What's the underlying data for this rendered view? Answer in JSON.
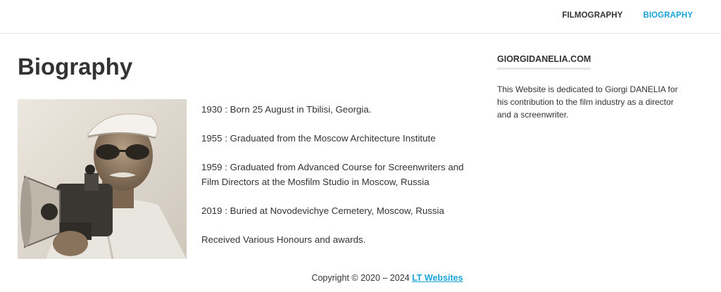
{
  "nav": {
    "items": [
      {
        "label": "FILMOGRAPHY"
      },
      {
        "label": "BIOGRAPHY"
      }
    ]
  },
  "page": {
    "title": "Biography"
  },
  "biography": {
    "entries": [
      "1930  : Born 25 August in Tbilisi, Georgia.",
      "1955 : Graduated from the Moscow Architecture Institute",
      "1959 : Graduated from Advanced Course for Screenwriters and Film Directors at the Mosfilm Studio in Moscow, Russia",
      "2019 : Buried at Novodevichye Cemetery, Moscow, Russia",
      "Received Various Honours and awards."
    ]
  },
  "sidebar": {
    "title": "GIORGIDANELIA.COM",
    "text": "This Website is dedicated to Giorgi DANELIA for his contribution to the film industry as a director and a screenwriter."
  },
  "footer": {
    "copyright": "Copyright © 2020 – 2024",
    "link_label": "LT Websites"
  },
  "colors": {
    "accent": "#1aa3d9",
    "text": "#333333"
  }
}
